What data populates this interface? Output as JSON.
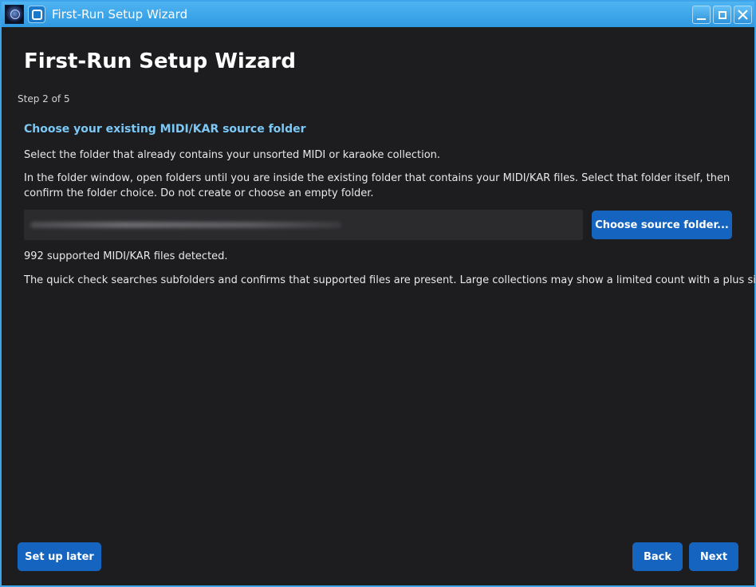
{
  "window": {
    "title": "First-Run Setup Wizard",
    "controls": {
      "minimize": "minimize-icon",
      "maximize": "maximize-icon",
      "close": "close-icon"
    }
  },
  "wizard": {
    "heading": "First-Run Setup Wizard",
    "step": "Step 2 of 5",
    "section_title": "Choose your existing MIDI/KAR source folder",
    "instruction_1": "Select the folder that already contains your unsorted MIDI or karaoke collection.",
    "instruction_2": "In the folder window, open folders until you are inside the existing folder that contains your MIDI/KAR files. Select that folder itself, then confirm the folder choice. Do not create or choose an empty folder.",
    "choose_button": "Choose source folder...",
    "detected_status": "992 supported MIDI/KAR files detected.",
    "check_note": "The quick check searches subfolders and confirms that supported files are present. Large collections may show a limited count with a plus sign."
  },
  "footer": {
    "setup_later": "Set up later",
    "back": "Back",
    "next": "Next"
  },
  "colors": {
    "accent": "#1565c0",
    "heading_accent": "#7cc8f6",
    "background": "#1d1d1f",
    "titlebar": "#2f98e0"
  }
}
